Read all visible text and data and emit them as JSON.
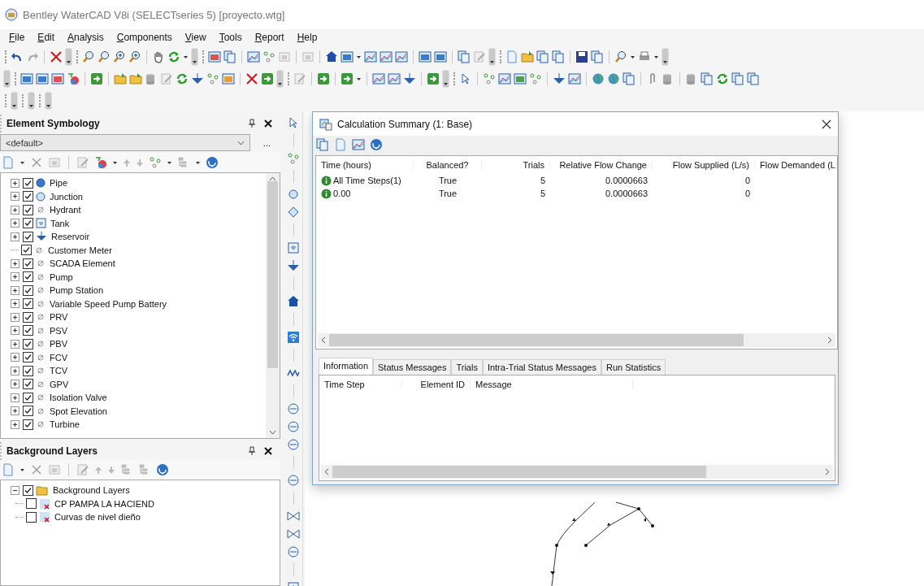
{
  "window": {
    "title": "Bentley WaterCAD V8i (SELECTseries 5) [proyecto.wtg]"
  },
  "menu": [
    "File",
    "Edit",
    "Analysis",
    "Components",
    "View",
    "Tools",
    "Report",
    "Help"
  ],
  "element_symbology": {
    "title": "Element Symbology",
    "selector": {
      "value": "<default>"
    },
    "browse_button": "...",
    "items": [
      {
        "label": "Pipe",
        "checked": true,
        "expandable": true,
        "kind": "pipe"
      },
      {
        "label": "Junction",
        "checked": true,
        "expandable": true,
        "kind": "junction"
      },
      {
        "label": "Hydrant",
        "checked": true,
        "expandable": true,
        "kind": "unsymbolized"
      },
      {
        "label": "Tank",
        "checked": true,
        "expandable": true,
        "kind": "tank"
      },
      {
        "label": "Reservoir",
        "checked": true,
        "expandable": true,
        "kind": "reservoir"
      },
      {
        "label": "Customer Meter",
        "checked": true,
        "expandable": false,
        "kind": "unsymbolized"
      },
      {
        "label": "SCADA Element",
        "checked": true,
        "expandable": true,
        "kind": "unsymbolized"
      },
      {
        "label": "Pump",
        "checked": true,
        "expandable": true,
        "kind": "unsymbolized"
      },
      {
        "label": "Pump Station",
        "checked": true,
        "expandable": true,
        "kind": "unsymbolized"
      },
      {
        "label": "Variable Speed Pump Battery",
        "checked": true,
        "expandable": true,
        "kind": "unsymbolized"
      },
      {
        "label": "PRV",
        "checked": true,
        "expandable": true,
        "kind": "unsymbolized"
      },
      {
        "label": "PSV",
        "checked": true,
        "expandable": true,
        "kind": "unsymbolized"
      },
      {
        "label": "PBV",
        "checked": true,
        "expandable": true,
        "kind": "unsymbolized"
      },
      {
        "label": "FCV",
        "checked": true,
        "expandable": true,
        "kind": "unsymbolized"
      },
      {
        "label": "TCV",
        "checked": true,
        "expandable": true,
        "kind": "unsymbolized"
      },
      {
        "label": "GPV",
        "checked": true,
        "expandable": true,
        "kind": "unsymbolized"
      },
      {
        "label": "Isolation Valve",
        "checked": true,
        "expandable": true,
        "kind": "unsymbolized"
      },
      {
        "label": "Spot Elevation",
        "checked": true,
        "expandable": true,
        "kind": "unsymbolized"
      },
      {
        "label": "Turbine",
        "checked": true,
        "expandable": true,
        "kind": "unsymbolized"
      }
    ]
  },
  "background_layers": {
    "title": "Background Layers",
    "items": [
      {
        "label": "Background Layers",
        "checked": true,
        "expanded": true,
        "kind": "folder",
        "children": [
          {
            "label": "CP PAMPA LA HACIEND",
            "checked": false,
            "kind": "layer"
          },
          {
            "label": "Curvas de nivel dieño",
            "checked": false,
            "kind": "layer"
          }
        ]
      }
    ]
  },
  "calculation_summary": {
    "title": "Calculation Summary (1: Base)",
    "columns": [
      "Time (hours)",
      "Balanced?",
      "Trials",
      "Relative Flow Change",
      "Flow Supplied (L/s)",
      "Flow Demanded (L"
    ],
    "rows": [
      {
        "cells": [
          "All Time Steps(1)",
          "True",
          "5",
          "0.0000663",
          "0"
        ]
      },
      {
        "cells": [
          "0.00",
          "True",
          "5",
          "0.0000663",
          "0"
        ]
      }
    ],
    "tabs": [
      {
        "label": "Information",
        "selected": true
      },
      {
        "label": "Status Messages",
        "selected": false
      },
      {
        "label": "Trials",
        "selected": false
      },
      {
        "label": "Intra-Trial Status Messages",
        "selected": false
      },
      {
        "label": "Run Statistics",
        "selected": false
      }
    ],
    "message_columns": [
      "Time Step",
      "Element ID",
      "Message"
    ]
  }
}
